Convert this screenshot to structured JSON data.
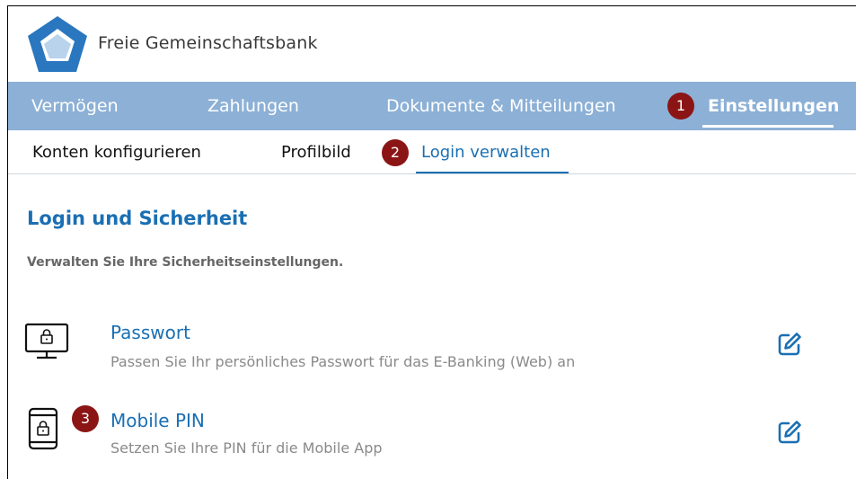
{
  "header": {
    "bank_name": "Freie Gemeinschaftsbank",
    "logo_icon": "pentagon-logo-icon"
  },
  "main_nav": {
    "items": [
      {
        "label": "Vermögen"
      },
      {
        "label": "Zahlungen"
      },
      {
        "label": "Dokumente & Mitteilungen"
      },
      {
        "label": "Einstellungen",
        "active": true
      }
    ]
  },
  "sub_nav": {
    "items": [
      {
        "label": "Konten konfigurieren"
      },
      {
        "label": "Profilbild"
      },
      {
        "label": "Login verwalten",
        "active": true
      }
    ]
  },
  "badges": [
    "1",
    "2",
    "3"
  ],
  "content": {
    "title": "Login und Sicherheit",
    "subtitle": "Verwalten Sie Ihre Sicherheitseinstellungen.",
    "rows": [
      {
        "icon": "monitor-lock-icon",
        "title": "Passwort",
        "description": "Passen Sie Ihr persönliches Passwort für das E-Banking (Web) an",
        "action_icon": "edit-icon"
      },
      {
        "icon": "phone-lock-icon",
        "title": "Mobile PIN",
        "description": "Setzen Sie Ihre PIN für die Mobile App",
        "action_icon": "edit-icon"
      }
    ]
  },
  "colors": {
    "nav_background": "#8cb0d6",
    "accent_blue": "#1a6fb3",
    "badge_red": "#8b1515",
    "logo_blue": "#2a77c0"
  }
}
